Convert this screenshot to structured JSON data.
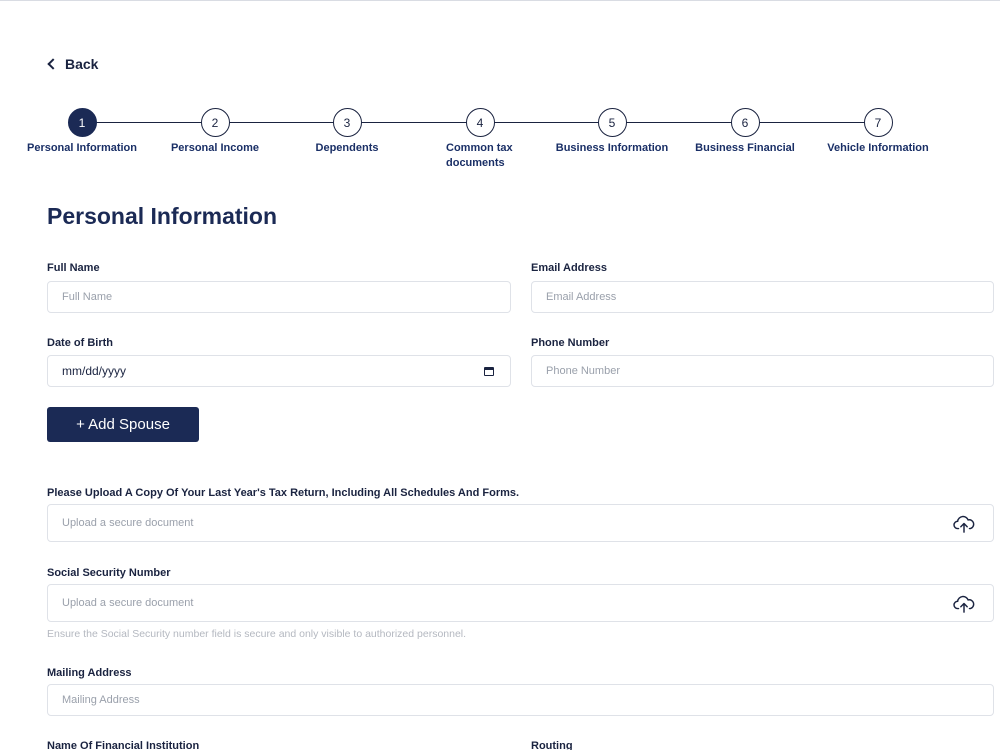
{
  "nav": {
    "back_label": "Back"
  },
  "stepper": {
    "steps": [
      {
        "number": "1",
        "label": "Personal Information"
      },
      {
        "number": "2",
        "label": "Personal Income"
      },
      {
        "number": "3",
        "label": "Dependents"
      },
      {
        "number": "4",
        "label": "Common tax documents"
      },
      {
        "number": "5",
        "label": "Business Information"
      },
      {
        "number": "6",
        "label": "Business Financial"
      },
      {
        "number": "7",
        "label": "Vehicle Information"
      }
    ],
    "active_step": 1
  },
  "page_title": "Personal Information",
  "form": {
    "full_name": {
      "label": "Full Name",
      "placeholder": "Full Name"
    },
    "email": {
      "label": "Email Address",
      "placeholder": "Email Address"
    },
    "dob": {
      "label": "Date of Birth",
      "value": "mm/dd/yyyy"
    },
    "phone": {
      "label": "Phone Number",
      "placeholder": "Phone Number"
    },
    "add_spouse_label": "+ Add Spouse",
    "tax_return": {
      "label": "Please Upload A Copy Of Your Last Year's Tax Return, Including All Schedules And Forms.",
      "placeholder": "Upload a secure document"
    },
    "ssn": {
      "label": "Social Security Number",
      "placeholder": "Upload a secure document",
      "hint": "Ensure the Social Security number field is secure and only visible to authorized personnel."
    },
    "mailing": {
      "label": "Mailing Address",
      "placeholder": "Mailing Address"
    },
    "institution": {
      "label": "Name Of Financial Institution"
    },
    "routing": {
      "label": "Routing"
    }
  },
  "colors": {
    "primary": "#1b2a55",
    "border": "#dfe2e8",
    "muted": "#9aa0ab"
  },
  "icons": {
    "back": "chevron-left-icon",
    "calendar": "calendar-icon",
    "upload": "cloud-upload-icon"
  }
}
